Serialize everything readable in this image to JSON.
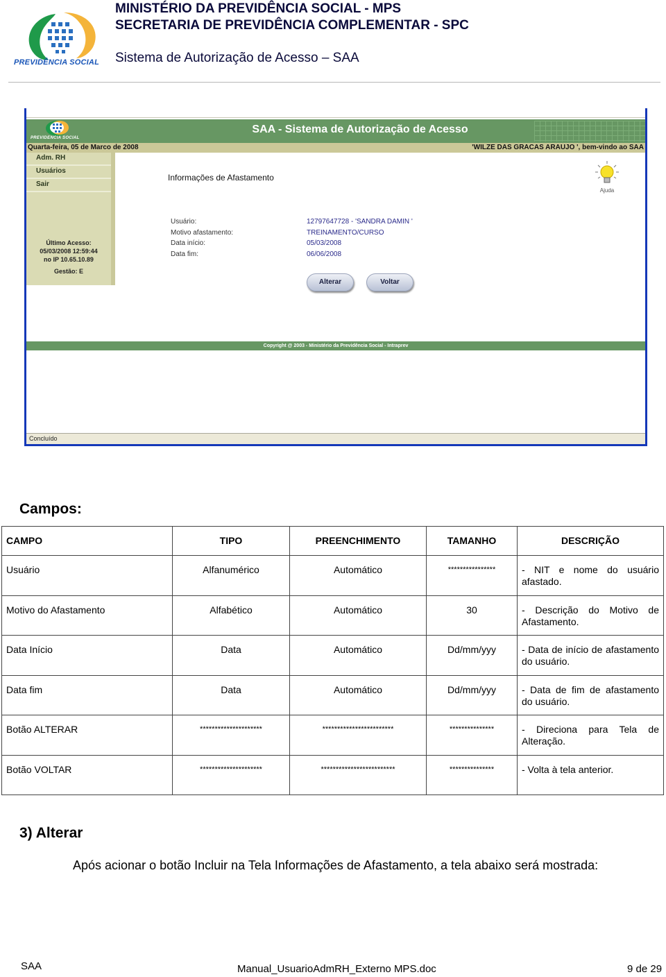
{
  "doc_header": {
    "logo_text": "PREVIDÊNCIA SOCIAL",
    "line1": "MINISTÉRIO DA PREVIDÊNCIA SOCIAL - MPS",
    "line2": "SECRETARIA DE PREVIDÊNCIA COMPLEMENTAR - SPC",
    "line3": "Sistema de Autorização de Acesso – SAA"
  },
  "screenshot": {
    "logo_text": "PREVIDENCIA SOCIAL",
    "banner_title": "SAA - Sistema de Autorização de Acesso",
    "date": "Quarta-feira, 05 de Marco de 2008",
    "welcome": "'WILZE DAS GRACAS ARAUJO ', bem-vindo ao SAA",
    "sidebar": {
      "items": [
        {
          "label": "Adm. RH"
        },
        {
          "label": "Usuários"
        },
        {
          "label": "Sair"
        }
      ],
      "last_access_label": "Último Acesso:",
      "last_access_datetime": "05/03/2008 12:59:44",
      "last_access_ip": "no IP 10.65.10.89",
      "gestao": "Gestão: E"
    },
    "page_title": "Informações de Afastamento",
    "help_label": "Ajuda",
    "form": {
      "fields": [
        {
          "label": "Usuário:",
          "value": "12797647728 - 'SANDRA DAMIN '"
        },
        {
          "label": "Motivo afastamento:",
          "value": "TREINAMENTO/CURSO"
        },
        {
          "label": "Data início:",
          "value": "05/03/2008"
        },
        {
          "label": "Data fim:",
          "value": "06/06/2008"
        }
      ]
    },
    "buttons": {
      "alterar": "Alterar",
      "voltar": "Voltar"
    },
    "footer": "Copyright @ 2003 - Ministério da Previdência Social - Intraprev",
    "status": "Concluído",
    "colors": {
      "banner": "#679763",
      "infobar": "#cbc898",
      "sidebar": "#dadbb4",
      "value_text": "#2a2a8a",
      "window_border": "#1538b8"
    }
  },
  "campos": {
    "title": "Campos:",
    "headers": [
      "CAMPO",
      "TIPO",
      "PREENCHIMENTO",
      "TAMANHO",
      "DESCRIÇÃO"
    ],
    "rows": [
      [
        "Usuário",
        "Alfanumérico",
        "Automático",
        "****************",
        "- NIT e nome do usuário afastado."
      ],
      [
        "Motivo do Afastamento",
        "Alfabético",
        "Automático",
        "30",
        "- Descrição do Motivo de Afastamento."
      ],
      [
        "Data Início",
        "Data",
        "Automático",
        "Dd/mm/yyy",
        "- Data de início de afastamento do usuário."
      ],
      [
        "Data fim",
        "Data",
        "Automático",
        "Dd/mm/yyy",
        "- Data de fim de afastamento do usuário."
      ],
      [
        "Botão ALTERAR",
        "*********************",
        "************************",
        "***************",
        "- Direciona para Tela de Alteração."
      ],
      [
        "Botão VOLTAR",
        "*********************",
        "*************************",
        "***************",
        "- Volta à tela anterior."
      ]
    ]
  },
  "section3": {
    "title": "3) Alterar",
    "body": "Após acionar o botão Incluir na Tela Informações de Afastamento, a tela abaixo será mostrada:"
  },
  "page_footer": {
    "left": "SAA",
    "center": "Manual_UsuarioAdmRH_Externo MPS.doc",
    "right": "9 de 29"
  }
}
